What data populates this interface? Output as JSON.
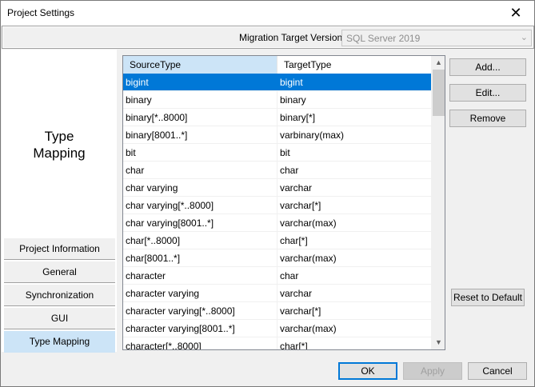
{
  "window": {
    "title": "Project Settings",
    "close_glyph": "✕"
  },
  "migration": {
    "label": "Migration Target Version :",
    "selected": "SQL Server 2019"
  },
  "left_panel": {
    "heading_line1": "Type",
    "heading_line2": "Mapping",
    "nav": [
      {
        "label": "Project Information"
      },
      {
        "label": "General"
      },
      {
        "label": "Synchronization"
      },
      {
        "label": "GUI"
      },
      {
        "label": "Type Mapping",
        "active": true
      }
    ]
  },
  "grid": {
    "columns": [
      "SourceType",
      "TargetType"
    ],
    "selected_index": 0,
    "rows": [
      [
        "bigint",
        "bigint"
      ],
      [
        "binary",
        "binary"
      ],
      [
        "binary[*..8000]",
        "binary[*]"
      ],
      [
        "binary[8001..*]",
        "varbinary(max)"
      ],
      [
        "bit",
        "bit"
      ],
      [
        "char",
        "char"
      ],
      [
        "char varying",
        "varchar"
      ],
      [
        "char varying[*..8000]",
        "varchar[*]"
      ],
      [
        "char varying[8001..*]",
        "varchar(max)"
      ],
      [
        "char[*..8000]",
        "char[*]"
      ],
      [
        "char[8001..*]",
        "varchar(max)"
      ],
      [
        "character",
        "char"
      ],
      [
        "character varying",
        "varchar"
      ],
      [
        "character varying[*..8000]",
        "varchar[*]"
      ],
      [
        "character varying[8001..*]",
        "varchar(max)"
      ],
      [
        "character[*..8000]",
        "char[*]"
      ]
    ]
  },
  "buttons": {
    "add": "Add...",
    "edit": "Edit...",
    "remove": "Remove",
    "reset": "Reset to Default",
    "ok": "OK",
    "apply": "Apply",
    "cancel": "Cancel"
  },
  "colors": {
    "selection": "#0078d7",
    "header_highlight": "#cce4f7"
  }
}
